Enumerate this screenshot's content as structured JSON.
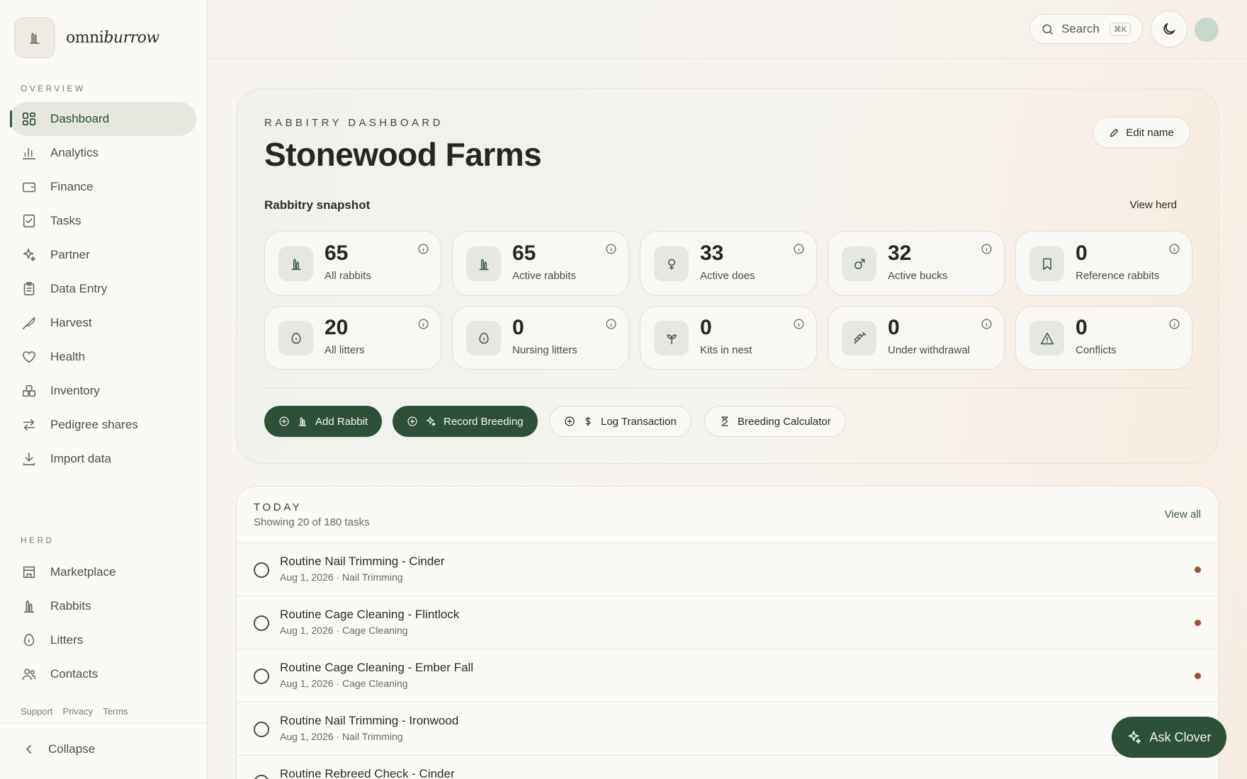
{
  "brand": {
    "name_regular": "omni",
    "name_italic": "burrow"
  },
  "sidebar": {
    "overview_label": "OVERVIEW",
    "overview_items": [
      {
        "label": "Dashboard",
        "icon": "dashboard-icon",
        "active": true
      },
      {
        "label": "Analytics",
        "icon": "bar-chart-icon"
      },
      {
        "label": "Finance",
        "icon": "wallet-icon"
      },
      {
        "label": "Tasks",
        "icon": "checklist-icon"
      },
      {
        "label": "Partner",
        "icon": "sparkle-icon"
      },
      {
        "label": "Data Entry",
        "icon": "clipboard-icon"
      },
      {
        "label": "Harvest",
        "icon": "knife-icon"
      },
      {
        "label": "Health",
        "icon": "heart-icon"
      },
      {
        "label": "Inventory",
        "icon": "boxes-icon"
      },
      {
        "label": "Pedigree shares",
        "icon": "swap-icon"
      },
      {
        "label": "Import data",
        "icon": "download-icon"
      }
    ],
    "herd_label": "HERD",
    "herd_items": [
      {
        "label": "Marketplace",
        "icon": "store-icon"
      },
      {
        "label": "Rabbits",
        "icon": "rabbit-icon"
      },
      {
        "label": "Litters",
        "icon": "egg-icon"
      },
      {
        "label": "Contacts",
        "icon": "users-icon"
      }
    ],
    "footer_links": [
      "Support",
      "Privacy",
      "Terms"
    ],
    "collapse_label": "Collapse"
  },
  "topbar": {
    "search_label": "Search",
    "search_shortcut": "⌘K"
  },
  "hero": {
    "eyebrow": "RABBITRY DASHBOARD",
    "title": "Stonewood Farms",
    "edit_label": "Edit name",
    "snapshot_label": "Rabbitry snapshot",
    "view_herd_label": "View herd",
    "stats": [
      {
        "value": "65",
        "label": "All rabbits",
        "icon": "rabbit-icon"
      },
      {
        "value": "65",
        "label": "Active rabbits",
        "icon": "rabbit-icon"
      },
      {
        "value": "33",
        "label": "Active does",
        "icon": "female-icon"
      },
      {
        "value": "32",
        "label": "Active bucks",
        "icon": "male-icon"
      },
      {
        "value": "0",
        "label": "Reference rabbits",
        "icon": "bookmark-icon"
      },
      {
        "value": "20",
        "label": "All litters",
        "icon": "egg-icon"
      },
      {
        "value": "0",
        "label": "Nursing litters",
        "icon": "egg-icon"
      },
      {
        "value": "0",
        "label": "Kits in nest",
        "icon": "sprout-icon"
      },
      {
        "value": "0",
        "label": "Under withdrawal",
        "icon": "syringe-icon"
      },
      {
        "value": "0",
        "label": "Conflicts",
        "icon": "warning-icon"
      }
    ],
    "actions": [
      {
        "label": "Add Rabbit",
        "style": "primary",
        "icon": "rabbit-icon"
      },
      {
        "label": "Record Breeding",
        "style": "primary",
        "icon": "sparkle-icon"
      },
      {
        "label": "Log Transaction",
        "style": "secondary",
        "icon": "dollar-icon"
      },
      {
        "label": "Breeding Calculator",
        "style": "secondary",
        "icon": "hourglass-icon"
      }
    ]
  },
  "today": {
    "eyebrow": "TODAY",
    "subtitle": "Showing 20 of 180 tasks",
    "view_all_label": "View all",
    "tasks": [
      {
        "title": "Routine Nail Trimming - Cinder",
        "meta": "Aug 1, 2026 · Nail Trimming"
      },
      {
        "title": "Routine Cage Cleaning - Flintlock",
        "meta": "Aug 1, 2026 · Cage Cleaning"
      },
      {
        "title": "Routine Cage Cleaning - Ember Fall",
        "meta": "Aug 1, 2026 · Cage Cleaning"
      },
      {
        "title": "Routine Nail Trimming - Ironwood",
        "meta": "Aug 1, 2026 · Nail Trimming"
      },
      {
        "title": "Routine Rebreed Check - Cinder",
        "meta": ""
      }
    ]
  },
  "ask_clover_label": "Ask Clover",
  "colors": {
    "accent": "#2e5038",
    "task_dot": "#a84a38",
    "active_nav_bg": "#e6e8df"
  }
}
